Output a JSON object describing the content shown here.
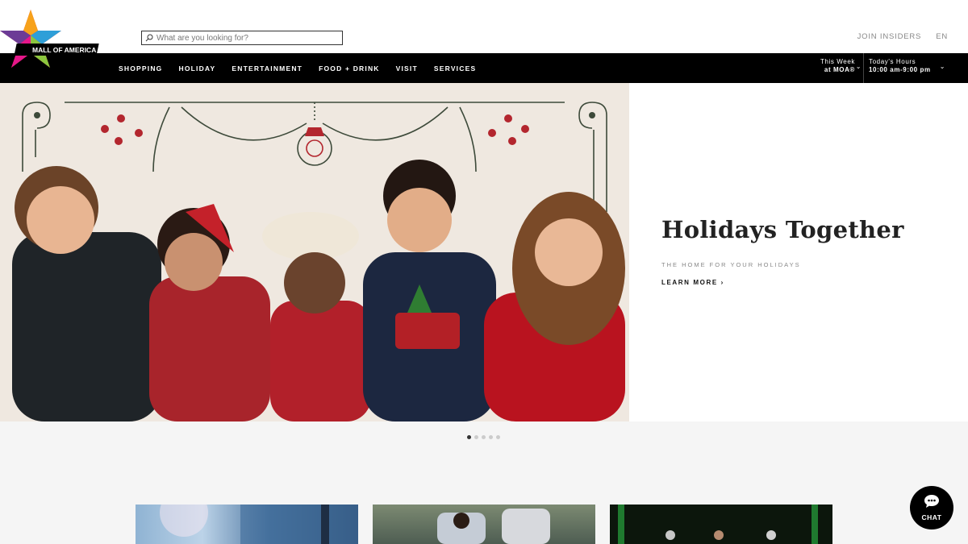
{
  "brand": {
    "logo_text": "MALL OF AMERICA"
  },
  "search": {
    "placeholder": "What are you looking for?"
  },
  "top_links": {
    "join": "JOIN INSIDERS",
    "lang": "EN"
  },
  "nav": {
    "items": [
      {
        "label": "SHOPPING"
      },
      {
        "label": "HOLIDAY"
      },
      {
        "label": "ENTERTAINMENT"
      },
      {
        "label": "FOOD + DRINK"
      },
      {
        "label": "VISIT"
      },
      {
        "label": "SERVICES"
      }
    ],
    "this_week_line1": "This Week",
    "this_week_line2": "at MOA®",
    "hours_line1": "Today's Hours",
    "hours_line2": "10:00 am-9:00 pm"
  },
  "hero": {
    "title": "Holidays Together",
    "subtitle": "THE HOME FOR YOUR HOLIDAYS",
    "cta": "LEARN MORE ›"
  },
  "carousel": {
    "total": 5,
    "active": 1
  },
  "chat": {
    "label": "CHAT"
  },
  "colors": {
    "nav_bg": "#000000",
    "accent_red": "#b3262e",
    "hero_bg": "#efe8e0"
  }
}
